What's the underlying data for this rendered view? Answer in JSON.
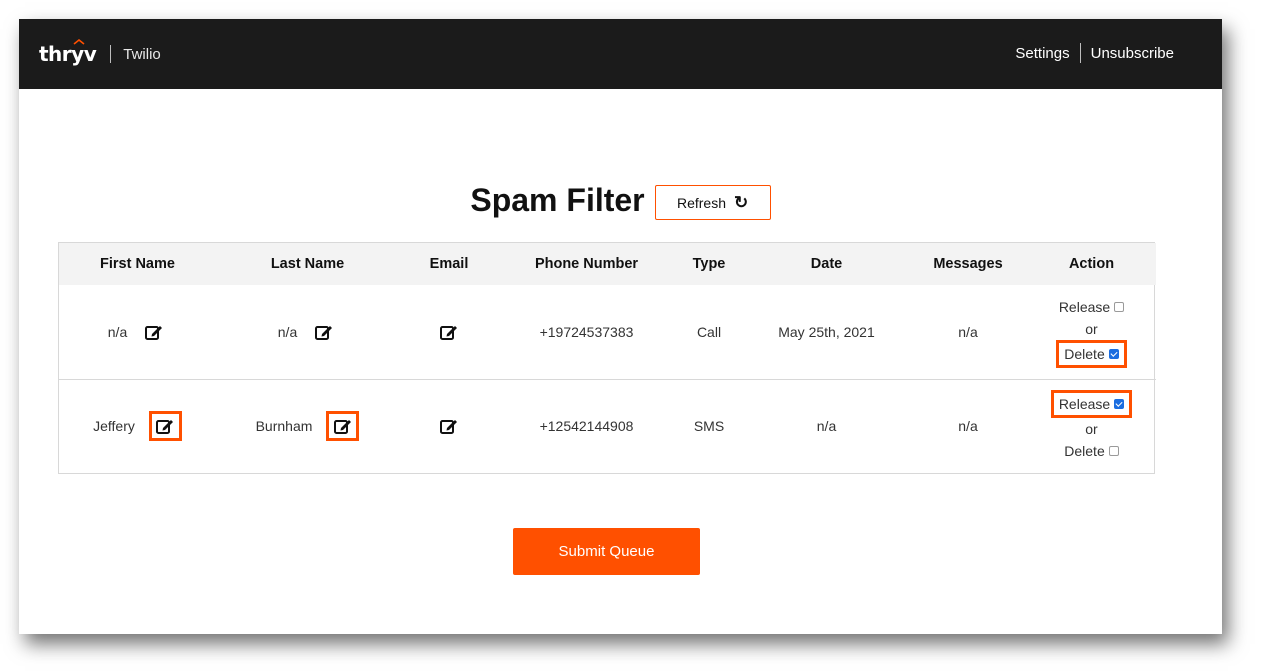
{
  "header": {
    "logo_text": "thryv",
    "product": "Twilio",
    "nav": {
      "settings": "Settings",
      "unsubscribe": "Unsubscribe"
    }
  },
  "page": {
    "title": "Spam Filter",
    "refresh_label": "Refresh",
    "refresh_icon": "↻"
  },
  "table": {
    "columns": [
      "First Name",
      "Last Name",
      "Email",
      "Phone Number",
      "Type",
      "Date",
      "Messages",
      "Action"
    ],
    "rows": [
      {
        "first_name": "n/a",
        "last_name": "n/a",
        "phone": "+19724537383",
        "type": "Call",
        "date": "May 25th, 2021",
        "messages": "n/a",
        "release": "Release",
        "or": "or",
        "delete": "Delete",
        "release_checked": false,
        "delete_checked": true
      },
      {
        "first_name": "Jeffery",
        "last_name": "Burnham",
        "phone": "+12542144908",
        "type": "SMS",
        "date": "n/a",
        "messages": "n/a",
        "release": "Release",
        "or": "or",
        "delete": "Delete",
        "release_checked": true,
        "delete_checked": false
      }
    ]
  },
  "submit_label": "Submit Queue",
  "colors": {
    "accent": "#ff5000",
    "topbar": "#1b1b1b",
    "checkbox": "#1a6de0"
  }
}
